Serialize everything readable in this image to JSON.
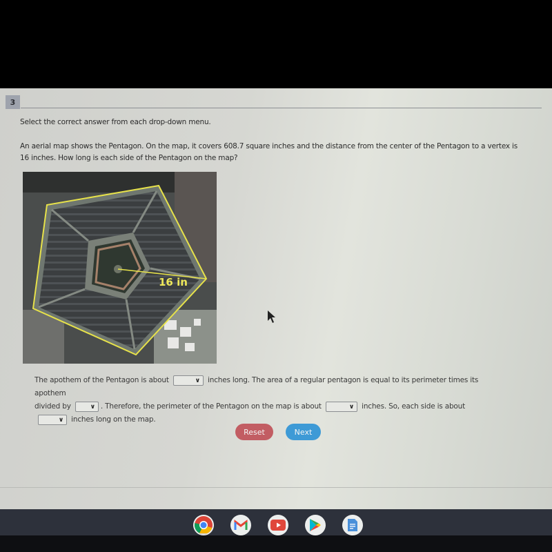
{
  "question": {
    "number": "3",
    "instruction": "Select the correct answer from each drop-down menu.",
    "prompt_line1": "An aerial map shows the Pentagon. On the map, it covers 608.7 square inches and the distance from the center of the Pentagon to a vertex is",
    "prompt_line2": "16 inches. How long is each side of the Pentagon on the map?",
    "image": {
      "description": "aerial photo of the Pentagon with yellow pentagon outline",
      "label": "16 in",
      "outline_color": "#e7e24a"
    },
    "answer": {
      "part1": "The apothem of the Pentagon is about",
      "part2": "inches long. The area of a regular pentagon is equal to its perimeter times its apothem",
      "part3": "divided by",
      "part4": ". Therefore, the perimeter of the Pentagon on the map is about",
      "part5": "inches. So, each side is about",
      "part6": "inches long on the map.",
      "dropdowns": [
        {
          "id": "apothem",
          "selected": ""
        },
        {
          "id": "divisor",
          "selected": ""
        },
        {
          "id": "perimeter",
          "selected": ""
        },
        {
          "id": "side",
          "selected": ""
        }
      ]
    }
  },
  "buttons": {
    "reset": "Reset",
    "next": "Next"
  },
  "colors": {
    "reset": "#c25d63",
    "next": "#3e9ad6"
  },
  "shelf": {
    "apps": [
      "chrome-icon",
      "gmail-icon",
      "youtube-icon",
      "play-store-icon",
      "docs-icon"
    ]
  }
}
